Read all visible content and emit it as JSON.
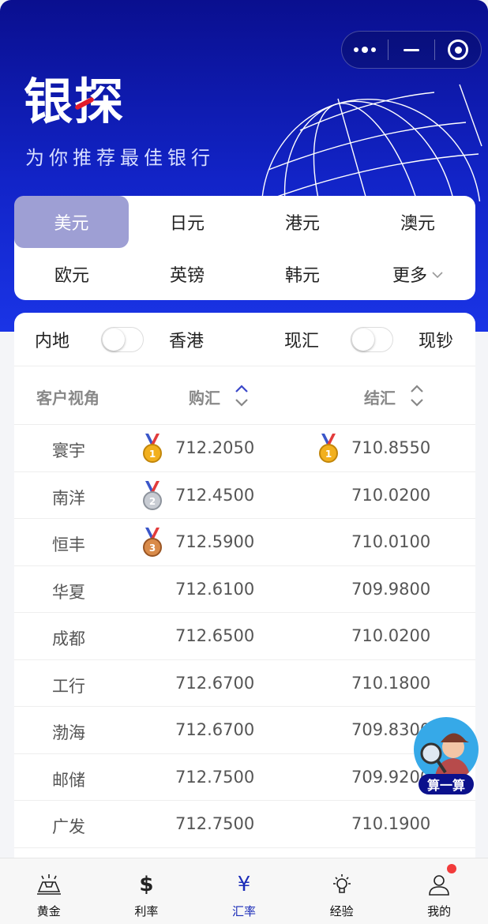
{
  "header": {
    "logo": "银探",
    "slogan": "为你推荐最佳银行"
  },
  "currencies": [
    {
      "label": "美元",
      "active": true
    },
    {
      "label": "日元"
    },
    {
      "label": "港元"
    },
    {
      "label": "澳元"
    },
    {
      "label": "欧元"
    },
    {
      "label": "英镑"
    },
    {
      "label": "韩元"
    },
    {
      "label": "更多"
    }
  ],
  "toggles": {
    "left_a": "内地",
    "left_b": "香港",
    "right_a": "现汇",
    "right_b": "现钞"
  },
  "table": {
    "col_bank": "客户视角",
    "col_buy": "购汇",
    "col_sell": "结汇",
    "rows": [
      {
        "bank": "寰宇",
        "buy": "712.2050",
        "sell": "710.8550",
        "buy_medal": "gold",
        "sell_medal": "gold"
      },
      {
        "bank": "南洋",
        "buy": "712.4500",
        "sell": "710.0200",
        "buy_medal": "silver"
      },
      {
        "bank": "恒丰",
        "buy": "712.5900",
        "sell": "710.0100",
        "buy_medal": "bronze"
      },
      {
        "bank": "华夏",
        "buy": "712.6100",
        "sell": "709.9800"
      },
      {
        "bank": "成都",
        "buy": "712.6500",
        "sell": "710.0200"
      },
      {
        "bank": "工行",
        "buy": "712.6700",
        "sell": "710.1800"
      },
      {
        "bank": "渤海",
        "buy": "712.6700",
        "sell": "709.8300"
      },
      {
        "bank": "邮储",
        "buy": "712.7500",
        "sell": "709.9200"
      },
      {
        "bank": "广发",
        "buy": "712.7500",
        "sell": "710.1900"
      }
    ]
  },
  "float_button": {
    "label": "算一算"
  },
  "tabbar": {
    "items": [
      {
        "label": "黄金",
        "icon": "gold-bar-icon"
      },
      {
        "label": "利率",
        "icon": "dollar-icon"
      },
      {
        "label": "汇率",
        "icon": "yen-icon",
        "active": true
      },
      {
        "label": "经验",
        "icon": "lightbulb-icon"
      },
      {
        "label": "我的",
        "icon": "user-icon"
      }
    ]
  },
  "colors": {
    "header_top": "#0a0f8f",
    "header_bottom": "#1a34e6",
    "active_currency": "#9e9fd4",
    "active_tab": "#1a2bb8",
    "badge": "#f23b3b"
  }
}
